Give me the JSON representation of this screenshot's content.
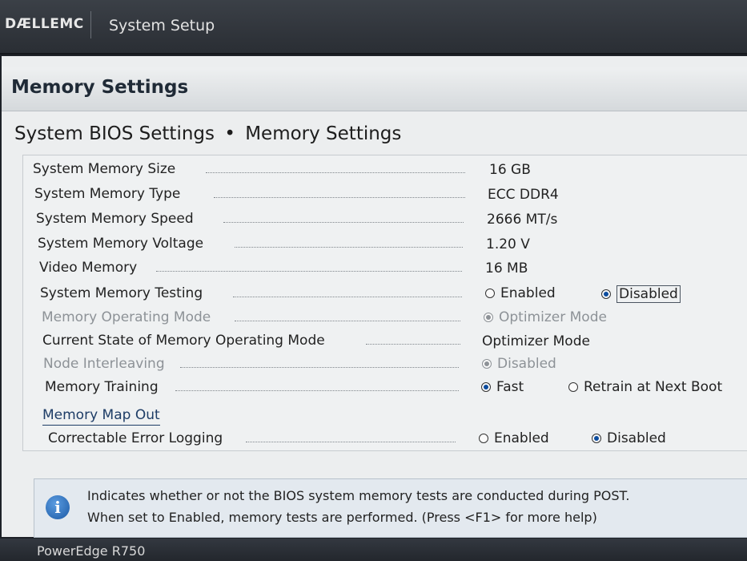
{
  "header": {
    "brand": "DÆLLEMC",
    "app_title": "System Setup"
  },
  "page": {
    "title": "Memory Settings",
    "breadcrumb": {
      "parent": "System BIOS Settings",
      "separator": "•",
      "current": "Memory Settings"
    }
  },
  "settings": [
    {
      "label": "System Memory Size",
      "value": "16 GB"
    },
    {
      "label": "System Memory Type",
      "value": "ECC DDR4"
    },
    {
      "label": "System Memory Speed",
      "value": "2666 MT/s"
    },
    {
      "label": "System Memory Voltage",
      "value": "1.20 V"
    },
    {
      "label": "Video Memory",
      "value": "16 MB"
    },
    {
      "label": "System Memory Testing",
      "options": [
        "Enabled",
        "Disabled"
      ],
      "selected": "Disabled"
    },
    {
      "label": "Memory Operating Mode",
      "options": [
        "Optimizer Mode"
      ],
      "selected": "Optimizer Mode",
      "disabled": true
    },
    {
      "label": "Current State of Memory Operating Mode",
      "value": "Optimizer Mode"
    },
    {
      "label": "Node Interleaving",
      "options": [
        "Disabled"
      ],
      "selected": "Disabled",
      "disabled": true
    },
    {
      "label": "Memory Training",
      "options": [
        "Fast",
        "Retrain at Next Boot"
      ],
      "selected": "Fast"
    },
    {
      "label": "Memory Map Out",
      "type": "link"
    },
    {
      "label": "Correctable Error Logging",
      "options": [
        "Enabled",
        "Disabled"
      ],
      "selected": "Disabled"
    }
  ],
  "help": {
    "icon": "info-icon",
    "line1": "Indicates whether or not the BIOS system memory tests are conducted during POST.",
    "line2": "When set to Enabled, memory tests are performed. (Press <F1> for more help)"
  },
  "footer": {
    "model": "PowerEdge R750"
  },
  "colors": {
    "accent": "#0c4c9e",
    "disabled_text": "#8d9297",
    "header_bg": "#2a2e34"
  }
}
